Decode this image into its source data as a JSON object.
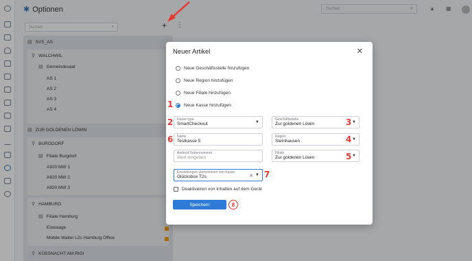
{
  "header": {
    "title": "Optionen",
    "search_placeholder": "Suchen"
  },
  "tree": {
    "search_placeholder": "Suchen",
    "groups": [
      {
        "name": "SVS_AS",
        "region": "WALCHWIL",
        "store": "Gemeindesaal",
        "items": [
          "AS 1",
          "AS 2",
          "AS 3",
          "AS 4"
        ]
      },
      {
        "name": "ZUR GOLDENEN LÖWIN",
        "regions": [
          {
            "name": "BURGDORF",
            "store": "Filiale Burgdorf",
            "items": [
              "A920 MW 1",
              "A920 MW 2",
              "A920 MW 3"
            ]
          },
          {
            "name": "HAMBURG",
            "store": "Filiale Hamburg",
            "items": [
              "Eiswaage",
              "Mobile Waiter L2s Hamburg Office"
            ]
          },
          {
            "name": "KÜSSNACHT AM RIGI"
          }
        ]
      }
    ]
  },
  "modal": {
    "title": "Neuer Artikel",
    "options": [
      {
        "label": "Neue Geschäftsstelle hinzufügen",
        "checked": false
      },
      {
        "label": "Neue Region hinzufügen",
        "checked": false
      },
      {
        "label": "Neue Filiale hinzufügen",
        "checked": false
      },
      {
        "label": "Neue Kasse hinzufügen",
        "checked": true
      }
    ],
    "fields": {
      "kasse_type": {
        "label": "Kasse type",
        "value": "SmartCheckout"
      },
      "geschaeftsstelle": {
        "label": "Geschäftsstelle",
        "value": "Zur goldenen Löwin"
      },
      "name": {
        "label": "Name",
        "value": "Testkasse 5"
      },
      "region": {
        "label": "Region",
        "value": "Steinhausen"
      },
      "serial": {
        "label": "Android Seriennummer",
        "placeholder": "Wert eingeben"
      },
      "filiale": {
        "label": "Filiale",
        "value": "Zur goldenen Löwin"
      },
      "einstellungen": {
        "label": "Einstellungen übernehmen von Kasse",
        "value": "Glücksbox T2s"
      }
    },
    "checkbox_label": "Deaktivieren von Inhalten auf dem Gerät",
    "save_label": "Speichern"
  },
  "annotations": [
    "1",
    "2",
    "3",
    "4",
    "5",
    "6",
    "7",
    "8"
  ],
  "colors": {
    "accent": "#2f7ad6",
    "annotation": "#e53935"
  }
}
